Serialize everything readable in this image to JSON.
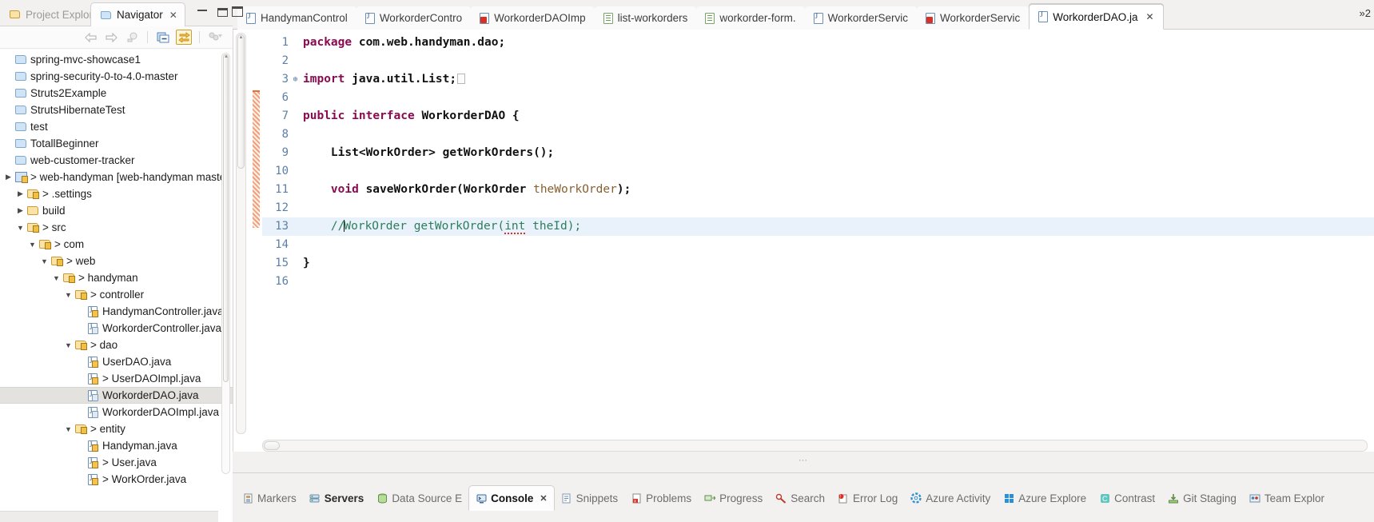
{
  "left_panel": {
    "tabs": [
      {
        "label": "Project Explorer",
        "active": false
      },
      {
        "label": "Navigator",
        "active": true,
        "close": "✕"
      }
    ],
    "window_buttons": {
      "minimize": "minimize",
      "maximize": "maximize"
    },
    "toolbar": [
      {
        "name": "back-icon",
        "glyph": "⇦"
      },
      {
        "name": "forward-icon",
        "glyph": "⇨"
      },
      {
        "name": "home-icon",
        "glyph": "⌂"
      },
      {
        "name": "collapse-all-icon",
        "glyph": "▤"
      },
      {
        "name": "link-with-editor-icon",
        "glyph": "⇆"
      },
      {
        "name": "view-menu-icon",
        "glyph": "▽"
      }
    ],
    "tree": [
      {
        "label": "spring-mvc-showcase1",
        "depth": 0,
        "arrow": "",
        "icon": "folder-plain"
      },
      {
        "label": "spring-security-0-to-4.0-master",
        "depth": 0,
        "arrow": "",
        "icon": "folder-plain"
      },
      {
        "label": "Struts2Example",
        "depth": 0,
        "arrow": "",
        "icon": "folder-plain"
      },
      {
        "label": "StrutsHibernateTest",
        "depth": 0,
        "arrow": "",
        "icon": "folder-plain"
      },
      {
        "label": "test",
        "depth": 0,
        "arrow": "",
        "icon": "folder-plain"
      },
      {
        "label": "TotallBeginner",
        "depth": 0,
        "arrow": "",
        "icon": "folder-plain"
      },
      {
        "label": "web-customer-tracker",
        "depth": 0,
        "arrow": "",
        "icon": "folder-plain"
      },
      {
        "label": "> web-handyman [web-handyman master",
        "depth": 0,
        "arrow": "▶",
        "icon": "project"
      },
      {
        "label": "> .settings",
        "depth": 1,
        "arrow": "▶",
        "icon": "folder-pkg"
      },
      {
        "label": "build",
        "depth": 1,
        "arrow": "▶",
        "icon": "folder-open"
      },
      {
        "label": "> src",
        "depth": 1,
        "arrow": "▼",
        "icon": "folder-pkg"
      },
      {
        "label": "> com",
        "depth": 2,
        "arrow": "▼",
        "icon": "folder-pkg"
      },
      {
        "label": "> web",
        "depth": 3,
        "arrow": "▼",
        "icon": "folder-pkg"
      },
      {
        "label": "> handyman",
        "depth": 4,
        "arrow": "▼",
        "icon": "folder-pkg"
      },
      {
        "label": "> controller",
        "depth": 5,
        "arrow": "▼",
        "icon": "folder-pkg"
      },
      {
        "label": "HandymanController.java",
        "depth": 6,
        "arrow": "",
        "icon": "java-lock"
      },
      {
        "label": "WorkorderController.java",
        "depth": 6,
        "arrow": "",
        "icon": "java-q"
      },
      {
        "label": "> dao",
        "depth": 5,
        "arrow": "▼",
        "icon": "folder-pkg"
      },
      {
        "label": "UserDAO.java",
        "depth": 6,
        "arrow": "",
        "icon": "java-lock"
      },
      {
        "label": "> UserDAOImpl.java",
        "depth": 6,
        "arrow": "",
        "icon": "java-lock"
      },
      {
        "label": "WorkorderDAO.java",
        "depth": 6,
        "arrow": "",
        "icon": "java-q",
        "selected": true
      },
      {
        "label": "WorkorderDAOImpl.java",
        "depth": 6,
        "arrow": "",
        "icon": "java-q"
      },
      {
        "label": "> entity",
        "depth": 5,
        "arrow": "▼",
        "icon": "folder-pkg"
      },
      {
        "label": "Handyman.java",
        "depth": 6,
        "arrow": "",
        "icon": "java-lock"
      },
      {
        "label": "> User.java",
        "depth": 6,
        "arrow": "",
        "icon": "java-lock"
      },
      {
        "label": "> WorkOrder.java",
        "depth": 6,
        "arrow": "",
        "icon": "java-lock"
      }
    ]
  },
  "editor_tabs": [
    {
      "label": "HandymanControl",
      "icon": "java-file-icon",
      "active": false
    },
    {
      "label": "WorkorderContro",
      "icon": "java-file-icon",
      "active": false
    },
    {
      "label": "WorkorderDAOImp",
      "icon": "java-error-file-icon",
      "active": false
    },
    {
      "label": "list-workorders",
      "icon": "xml-file-icon",
      "active": false
    },
    {
      "label": "workorder-form.",
      "icon": "xml-file-icon",
      "active": false
    },
    {
      "label": "WorkorderServic",
      "icon": "java-file-icon",
      "active": false
    },
    {
      "label": "WorkorderServic",
      "icon": "java-error-file-icon",
      "active": false
    },
    {
      "label": "WorkorderDAO.ja",
      "icon": "java-file-icon",
      "active": true,
      "close": "✕"
    }
  ],
  "editor_overflow": "»2",
  "code": {
    "lines": [
      {
        "num": "1",
        "fold": "",
        "cur": false,
        "tokens": [
          {
            "t": "package",
            "c": "kw"
          },
          {
            "t": " ",
            "c": "plain"
          },
          {
            "t": "com.web.handyman.dao;",
            "c": "id"
          }
        ]
      },
      {
        "num": "2",
        "fold": "",
        "cur": false,
        "tokens": []
      },
      {
        "num": "3",
        "fold": "⊕",
        "cur": false,
        "tokens": [
          {
            "t": "import",
            "c": "kw"
          },
          {
            "t": " ",
            "c": "plain"
          },
          {
            "t": "java.util.List;",
            "c": "id"
          },
          {
            "t": "",
            "c": "foldbox"
          }
        ]
      },
      {
        "num": "6",
        "fold": "",
        "cur": false,
        "tokens": []
      },
      {
        "num": "7",
        "fold": "",
        "cur": false,
        "tokens": [
          {
            "t": "public",
            "c": "kw"
          },
          {
            "t": " ",
            "c": "plain"
          },
          {
            "t": "interface",
            "c": "kw"
          },
          {
            "t": " ",
            "c": "plain"
          },
          {
            "t": "WorkorderDAO {",
            "c": "id"
          }
        ]
      },
      {
        "num": "8",
        "fold": "",
        "cur": false,
        "tokens": []
      },
      {
        "num": "9",
        "fold": "",
        "cur": false,
        "tokens": [
          {
            "t": "    List<WorkOrder> getWorkOrders();",
            "c": "id"
          }
        ]
      },
      {
        "num": "10",
        "fold": "",
        "cur": false,
        "tokens": []
      },
      {
        "num": "11",
        "fold": "",
        "cur": false,
        "tokens": [
          {
            "t": "    ",
            "c": "plain"
          },
          {
            "t": "void",
            "c": "kw"
          },
          {
            "t": " saveWorkOrder(WorkOrder ",
            "c": "id"
          },
          {
            "t": "theWorkOrder",
            "c": "param"
          },
          {
            "t": ");",
            "c": "id"
          }
        ]
      },
      {
        "num": "12",
        "fold": "",
        "cur": false,
        "tokens": []
      },
      {
        "num": "13",
        "fold": "",
        "cur": true,
        "tokens": [
          {
            "t": "    //",
            "c": "cmt"
          },
          {
            "t": "",
            "c": "caret"
          },
          {
            "t": "WorkOrder getWorkOrder(",
            "c": "cmt"
          },
          {
            "t": "int",
            "c": "cmt-sq"
          },
          {
            "t": " theId);",
            "c": "cmt"
          }
        ]
      },
      {
        "num": "14",
        "fold": "",
        "cur": false,
        "tokens": []
      },
      {
        "num": "15",
        "fold": "",
        "cur": false,
        "tokens": [
          {
            "t": "}",
            "c": "id"
          }
        ]
      },
      {
        "num": "16",
        "fold": "",
        "cur": false,
        "tokens": []
      }
    ]
  },
  "view_tabs": [
    {
      "label": "Markers",
      "icon": "markers-icon",
      "style": "normal"
    },
    {
      "label": "Servers",
      "icon": "servers-icon",
      "style": "bold"
    },
    {
      "label": "Data Source E",
      "icon": "data-source-icon",
      "style": "normal"
    },
    {
      "label": "Console",
      "icon": "console-icon",
      "style": "active",
      "close": "✕"
    },
    {
      "label": "Snippets",
      "icon": "snippets-icon",
      "style": "normal"
    },
    {
      "label": "Problems",
      "icon": "problems-icon",
      "style": "normal"
    },
    {
      "label": "Progress",
      "icon": "progress-icon",
      "style": "normal"
    },
    {
      "label": "Search",
      "icon": "search-icon",
      "style": "normal"
    },
    {
      "label": "Error Log",
      "icon": "error-log-icon",
      "style": "normal"
    },
    {
      "label": "Azure Activity",
      "icon": "azure-activity-icon",
      "style": "normal"
    },
    {
      "label": "Azure Explore",
      "icon": "azure-explore-icon",
      "style": "normal"
    },
    {
      "label": "Contrast",
      "icon": "contrast-icon",
      "style": "normal"
    },
    {
      "label": "Git Staging",
      "icon": "git-staging-icon",
      "style": "normal"
    },
    {
      "label": "Team Explor",
      "icon": "team-explorer-icon",
      "style": "normal"
    }
  ],
  "colors": {
    "keyword": "#8b0a50",
    "comment": "#2e7d5b",
    "parameter": "#8a6030",
    "line_number": "#5c7fa8",
    "current_line_bg": "#e9f2fb",
    "change_bar": "#e4703a",
    "selection_bg": "#e4e2df"
  }
}
